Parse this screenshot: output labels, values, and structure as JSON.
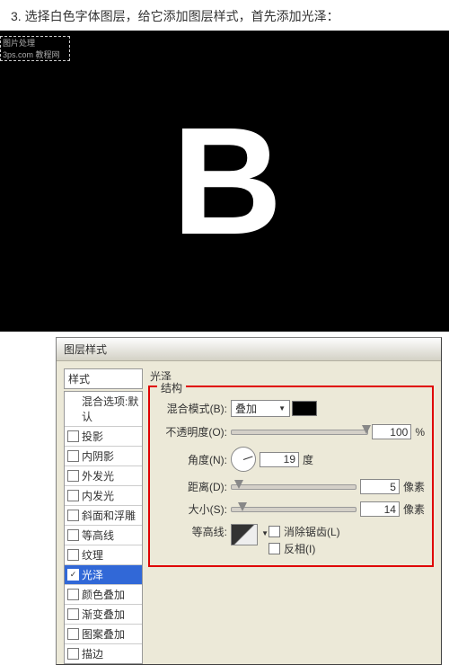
{
  "instruction": "3. 选择白色字体图层，给它添加图层样式，首先添加光泽：",
  "watermark": {
    "l1": "图片处理",
    "l2": "3ps.com 教程网"
  },
  "big_letter": "B",
  "dialog": {
    "title": "图层样式",
    "styles_header": "样式",
    "styles": [
      {
        "label": "混合选项:默认",
        "has_checkbox": false,
        "checked": false
      },
      {
        "label": "投影",
        "has_checkbox": true,
        "checked": false
      },
      {
        "label": "内阴影",
        "has_checkbox": true,
        "checked": false
      },
      {
        "label": "外发光",
        "has_checkbox": true,
        "checked": false
      },
      {
        "label": "内发光",
        "has_checkbox": true,
        "checked": false
      },
      {
        "label": "斜面和浮雕",
        "has_checkbox": true,
        "checked": false
      },
      {
        "label": "等高线",
        "has_checkbox": true,
        "checked": false
      },
      {
        "label": "纹理",
        "has_checkbox": true,
        "checked": false
      },
      {
        "label": "光泽",
        "has_checkbox": true,
        "checked": true,
        "selected": true
      },
      {
        "label": "颜色叠加",
        "has_checkbox": true,
        "checked": false
      },
      {
        "label": "渐变叠加",
        "has_checkbox": true,
        "checked": false
      },
      {
        "label": "图案叠加",
        "has_checkbox": true,
        "checked": false
      },
      {
        "label": "描边",
        "has_checkbox": true,
        "checked": false
      }
    ],
    "panel": {
      "section_title": "光泽",
      "group_title": "结构",
      "blend_mode": {
        "label": "混合模式(B):",
        "value": "叠加",
        "color": "#000000"
      },
      "opacity": {
        "label": "不透明度(O):",
        "value": "100",
        "unit": "%",
        "percent": 100
      },
      "angle": {
        "label": "角度(N):",
        "value": "19",
        "unit": "度"
      },
      "distance": {
        "label": "距离(D):",
        "value": "5",
        "unit": "像素",
        "percent": 3
      },
      "size": {
        "label": "大小(S):",
        "value": "14",
        "unit": "像素",
        "percent": 6
      },
      "contour": {
        "label": "等高线:",
        "anti_alias": "消除锯齿(L)",
        "invert": "反相(I)"
      }
    }
  }
}
